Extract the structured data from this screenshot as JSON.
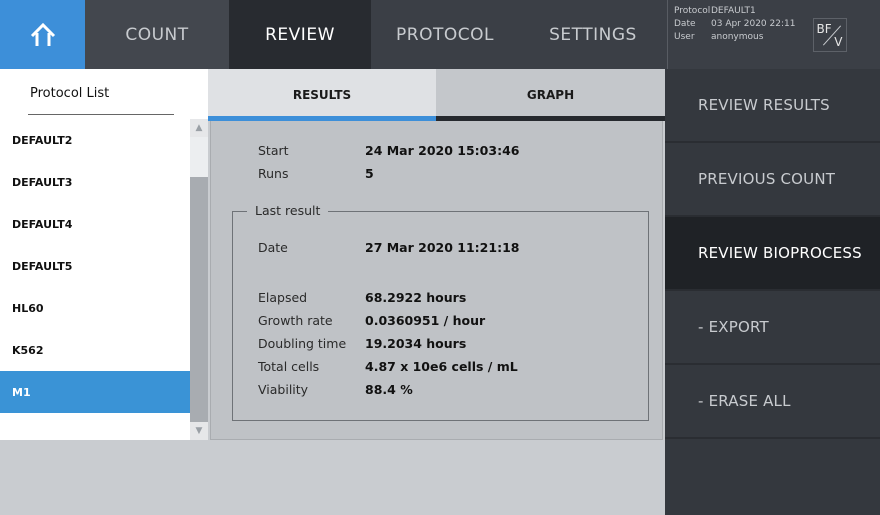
{
  "nav": {
    "count": "COUNT",
    "review": "REVIEW",
    "protocol": "PROTOCOL",
    "settings": "SETTINGS"
  },
  "info": {
    "protocol_key": "Protocol",
    "protocol_val": "DEFAULT1",
    "date_key": "Date",
    "date_val": "03 Apr 2020 22:11",
    "user_key": "User",
    "user_val": "anonymous"
  },
  "mode_toggle": {
    "top": "BF",
    "bottom": "V"
  },
  "protocol_list": {
    "title": "Protocol List",
    "items": [
      "DEFAULT2",
      "DEFAULT3",
      "DEFAULT4",
      "DEFAULT5",
      "HL60",
      "K562",
      "M1"
    ],
    "selected": "M1"
  },
  "tabs": {
    "results": "RESULTS",
    "graph": "GRAPH",
    "active": "RESULTS"
  },
  "results": {
    "start_label": "Start",
    "start_value": "24 Mar 2020 15:03:46",
    "runs_label": "Runs",
    "runs_value": "5",
    "last_result_label": "Last result",
    "date_label": "Date",
    "date_value": "27 Mar 2020 11:21:18",
    "elapsed_label": "Elapsed",
    "elapsed_value": "68.2922 hours",
    "growth_label": "Growth rate",
    "growth_value": "0.0360951 / hour",
    "doubling_label": "Doubling time",
    "doubling_value": "19.2034 hours",
    "total_label": "Total cells",
    "total_value": "4.87 x 10e6 cells / mL",
    "viability_label": "Viability",
    "viability_value": "88.4 %"
  },
  "right_menu": {
    "review_results": "REVIEW RESULTS",
    "previous_count": "PREVIOUS COUNT",
    "review_bioprocess": "REVIEW BIOPROCESS",
    "export": "- EXPORT",
    "erase_all": "- ERASE ALL"
  },
  "colors": {
    "accent": "#3d8fd9",
    "topbar": "#3b3f46",
    "panel_dark": "#34383e"
  }
}
